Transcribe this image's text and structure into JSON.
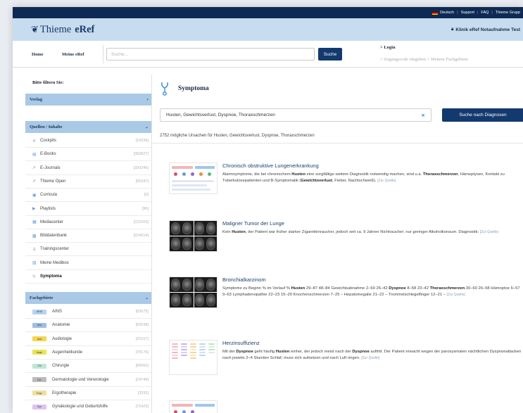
{
  "utility": {
    "language": "Deutsch",
    "support": "Support",
    "faq": "FAQ",
    "group": "Thieme Grupp"
  },
  "brand": {
    "name": "Thieme",
    "product": "eRef",
    "institution": "Klinik eRef Notaufnahme Test"
  },
  "nav": {
    "home": "Home",
    "my": "Meine eRef",
    "search_placeholder": "Suche...",
    "search_button": "Suche",
    "login": "> Login",
    "access": "> Zugangscode eingeben   > Weitere Fachgebiete"
  },
  "sidebar": {
    "filter_title": "Bitte filtern Sie:",
    "publisher": "Verlag",
    "sources_title": "Quellen / Inhalte",
    "sources": [
      {
        "icon": "cockpit-icon",
        "glyph": "✕",
        "label": "Cockpits",
        "count": "[10036]"
      },
      {
        "icon": "book-icon",
        "glyph": "▤",
        "label": "E-Books",
        "count": "[360827]"
      },
      {
        "icon": "journal-icon",
        "glyph": "⇗",
        "label": "E-Journals",
        "count": "[330345]"
      },
      {
        "icon": "open-icon",
        "glyph": "⇗",
        "label": "Thieme Open",
        "count": "[55347]"
      },
      {
        "icon": "curricula-icon",
        "glyph": "▣",
        "label": "Curricula",
        "count": "[0]"
      },
      {
        "icon": "playlist-icon",
        "glyph": "▶",
        "label": "Playlists",
        "count": "[96]"
      },
      {
        "icon": "media-icon",
        "glyph": "▦",
        "label": "Mediacenter",
        "count": "[221003]"
      },
      {
        "icon": "image-db-icon",
        "glyph": "▩",
        "label": "Bilddatenbank",
        "count": "[224914]"
      },
      {
        "icon": "training-icon",
        "glyph": "♙",
        "label": "Trainingscenter",
        "count": ""
      },
      {
        "icon": "medibox-icon",
        "glyph": "▧",
        "label": "Meine Medibox",
        "count": ""
      },
      {
        "icon": "symptom-icon",
        "glyph": "✎",
        "label": "Symptoma",
        "count": ""
      }
    ],
    "fields_title": "Fachgebiete",
    "fields": [
      {
        "badge": "AINS",
        "color": "#b5d3ef",
        "label": "AINS",
        "count": "[83675]"
      },
      {
        "badge": "Ana",
        "color": "#9dbde6",
        "label": "Anatomie",
        "count": "[55538]"
      },
      {
        "badge": "Aud",
        "color": "#f6d54f",
        "label": "Audiologie",
        "count": "[33157]"
      },
      {
        "badge": "Auge",
        "color": "#e9e452",
        "label": "Augenheilkunde",
        "count": "[78176]"
      },
      {
        "badge": "Chi",
        "color": "#bfe6d6",
        "label": "Chirurgie",
        "count": "[89062]"
      },
      {
        "badge": "Der",
        "color": "#bbbbbb",
        "label": "Dermatologie und Venerologie",
        "count": "[24744]"
      },
      {
        "badge": "Ergo",
        "color": "#f0e09e",
        "label": "Ergotherapie",
        "count": "[3333]"
      },
      {
        "badge": "Gyn",
        "color": "#dcc3ef",
        "label": "Gynäkologie und Geburtshilfe",
        "count": "[72423]"
      }
    ]
  },
  "symptoma": {
    "title": "Symptoma",
    "query": "Husten, Gewichtsverlust, Dyspnoe, Thoraxschmerzen",
    "clear": "×",
    "button": "Suche nach Diagnosen",
    "count_text": "2752 mögliche Ursachen für Husten, Gewichtsverlust, Dyspnoe, Thoraxschmerzen"
  },
  "results": [
    {
      "title": "Chronisch obstruktive Lungenerkrankung",
      "desc_html": "Alarmsymptome, die bei chronischem <b>Husten</b> eine sorgfältige weitere Diagnostik notwendig machen, sind u.a. <b>Thoraxschmerzen</b>, Hämoptysen, Kontakt zu Tuberkulosepatienten und B-Symptomatik (<b>Gewichtsverlust</b>, Fieber, Nachtschweiß).",
      "source": "[Zur Quelle]"
    },
    {
      "title": "Maligner Tumor der Lunge",
      "desc_html": "Kein <b>Husten</b>, der Patient war früher starker Zigarettenraucher, jedoch seit ca. 9 Jahren Nichtraucher; nur geringer Alkoholkonsum. Diagnostik:",
      "source": "[Zur Quelle]"
    },
    {
      "title": "Bronchialkarzinom",
      "desc_html": "Symptome zu Beginn % im Verlauf % <b>Husten</b> 29–87 48–84 Gewichtsabnahme 2–69 26–42 <b>Dyspnoe</b> 8–58 23–42 <b>Thoraxschmerzen</b> 30–60 26–58 Hämoptoe 6–57 9–63 Lymphadenopathie 22–23 15–20 Knochenschmerzen 7–25 – Hepatomegalie 21–22 – Trommelschlegelfinger 12–21 –",
      "source": "[Zur Quelle]"
    },
    {
      "title": "Herzinsuffizienz",
      "desc_html": "Mit der <b>Dyspnoe</b> geht häufig <b>Husten</b> einher, der jedoch meist nach der <b>Dyspnoe</b> auftritt. Der Patient erwacht wegen der paroxysmalen nächtlichen Dyspnoeattacken nach jeweils 2–4 Stunden Schlaf, muss sich aufsetzen und nach Luft ringen.",
      "source": "[Zur Quelle]"
    }
  ]
}
